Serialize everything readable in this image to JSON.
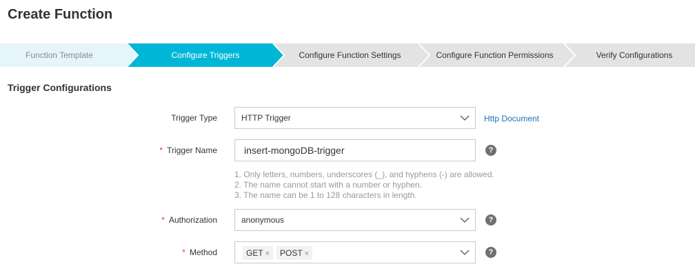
{
  "page": {
    "title": "Create Function"
  },
  "stepper": {
    "steps": [
      {
        "label": "Function Template",
        "state": "done"
      },
      {
        "label": "Configure Triggers",
        "state": "active"
      },
      {
        "label": "Configure Function Settings",
        "state": "pending"
      },
      {
        "label": "Configure Function Permissions",
        "state": "pending"
      },
      {
        "label": "Verify Configurations",
        "state": "pending"
      }
    ],
    "colors": {
      "done": "#e6f5fa",
      "active": "#00b6d6",
      "pending": "#e3e3e3"
    }
  },
  "section": {
    "title": "Trigger Configurations"
  },
  "form": {
    "trigger_type": {
      "label": "Trigger Type",
      "value": "HTTP Trigger",
      "doc_link": "Http Document",
      "icon": "chevron-down-icon"
    },
    "trigger_name": {
      "label": "Trigger Name",
      "required_mark": "*",
      "value": "insert-mongoDB-trigger",
      "help": "?",
      "hints": [
        "1. Only letters, numbers, underscores (_), and hyphens (-) are allowed.",
        "2. The name cannot start with a number or hyphen.",
        "3. The name can be 1 to 128 characters in length."
      ]
    },
    "authorization": {
      "label": "Authorization",
      "required_mark": "*",
      "value": "anonymous",
      "help": "?",
      "icon": "chevron-down-icon"
    },
    "method": {
      "label": "Method",
      "required_mark": "*",
      "tags": [
        "GET",
        "POST"
      ],
      "tag_remove": "×",
      "help": "?",
      "icon": "chevron-down-icon"
    }
  },
  "colors": {
    "link": "#1f6fb5",
    "required": "#e4393c",
    "help_bg": "#707070"
  }
}
